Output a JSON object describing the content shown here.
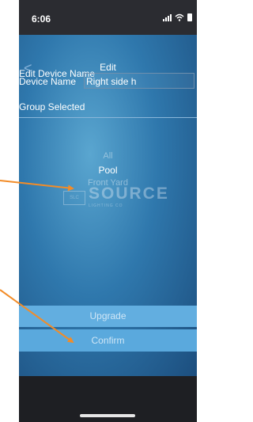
{
  "status_bar": {
    "time": "6:06",
    "icons": [
      "signal-icon",
      "wifi-icon",
      "battery-icon"
    ]
  },
  "nav": {
    "back_icon": "chevron-left-icon",
    "back_glyph": "<",
    "title": "Edit"
  },
  "form": {
    "section_label": "Edit Device Name",
    "device_name_label": "Device Name",
    "device_name_value": "Right side h",
    "group_label": "Group Selected"
  },
  "picker": {
    "items": [
      "All",
      "Pool",
      "Front Yard"
    ],
    "selected": "Pool"
  },
  "watermark": {
    "box_text": "SLC",
    "text": "SOURCE",
    "subtext": "LIGHTING CO"
  },
  "buttons": {
    "upgrade": "Upgrade",
    "confirm": "Confirm"
  },
  "colors": {
    "accent": "#5aa9dd",
    "annotation_arrow": "#f28c28"
  }
}
